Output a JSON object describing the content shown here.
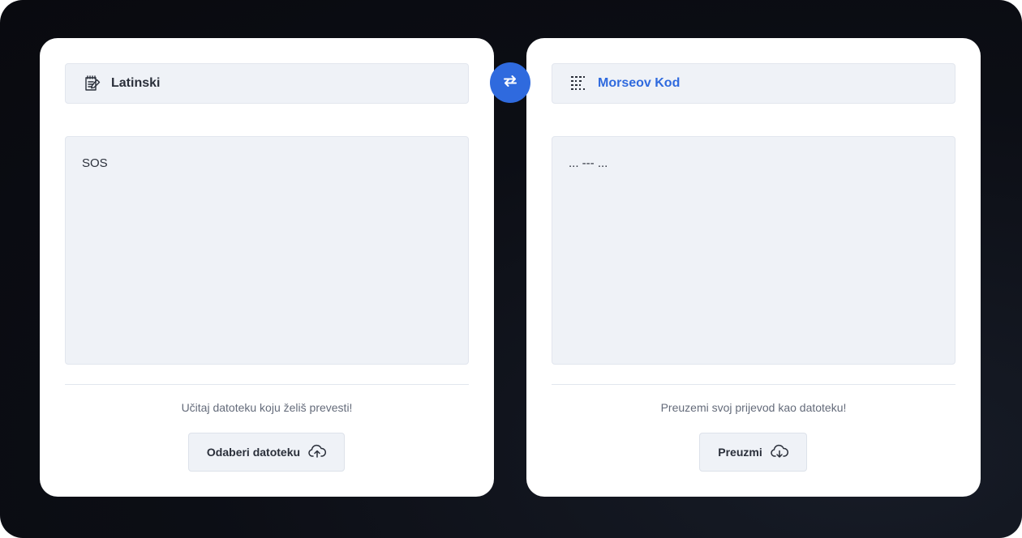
{
  "source": {
    "language": "Latinski",
    "language_icon": "notepad-icon",
    "text": "SOS",
    "hint": "Učitaj datoteku koju želiš prevesti!",
    "button_label": "Odaberi datoteku",
    "button_icon": "cloud-upload-icon"
  },
  "swap": {
    "icon": "swap-arrows-icon"
  },
  "target": {
    "language": "Morseov Kod",
    "language_icon": "morse-dots-icon",
    "text": "... --- ...",
    "hint": "Preuzemi svoj prijevod kao datoteku!",
    "button_label": "Preuzmi",
    "button_icon": "cloud-download-icon"
  },
  "colors": {
    "accent": "#2f6ade",
    "panel_bg": "#eff2f7",
    "background": "#0c0e15",
    "card": "#ffffff"
  }
}
